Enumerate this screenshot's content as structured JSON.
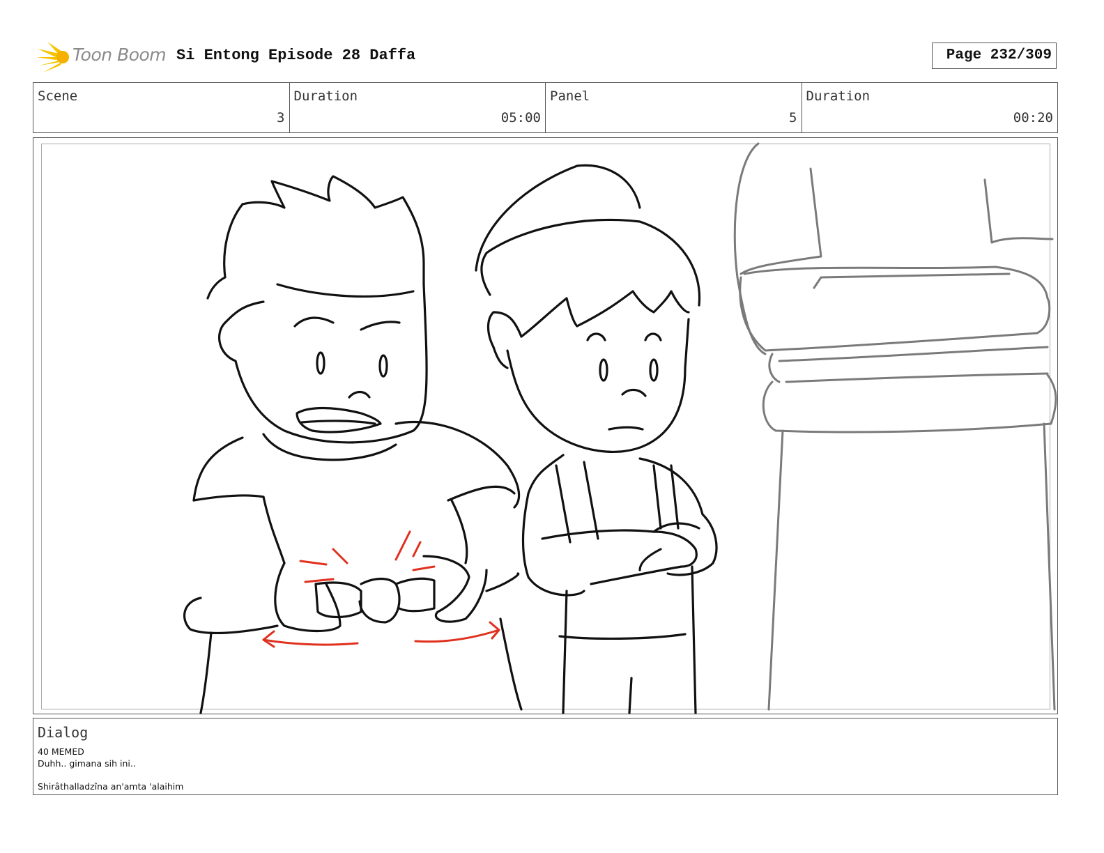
{
  "header": {
    "logo_text": "Toon Boom",
    "title": "Si Entong Episode 28 Daffa",
    "page": "Page 232/309"
  },
  "info": [
    {
      "label": "Scene",
      "value": "3"
    },
    {
      "label": "Duration",
      "value": "05:00"
    },
    {
      "label": "Panel",
      "value": "5"
    },
    {
      "label": "Duration",
      "value": "00:20"
    }
  ],
  "panel_image": {
    "description_icon": "storyboard-sketch",
    "line_color": "#111111",
    "accent_color": "#e0301e",
    "pencil_color": "#7a7a7a"
  },
  "dialog": {
    "label": "Dialog",
    "line1": "40 MEMED",
    "line2": "Duhh.. gimana sih ini..",
    "line3": "Shirâthalladzîna an'amta 'alaihim"
  },
  "colors": {
    "logo_star": "#f5c400",
    "border": "#555555"
  }
}
